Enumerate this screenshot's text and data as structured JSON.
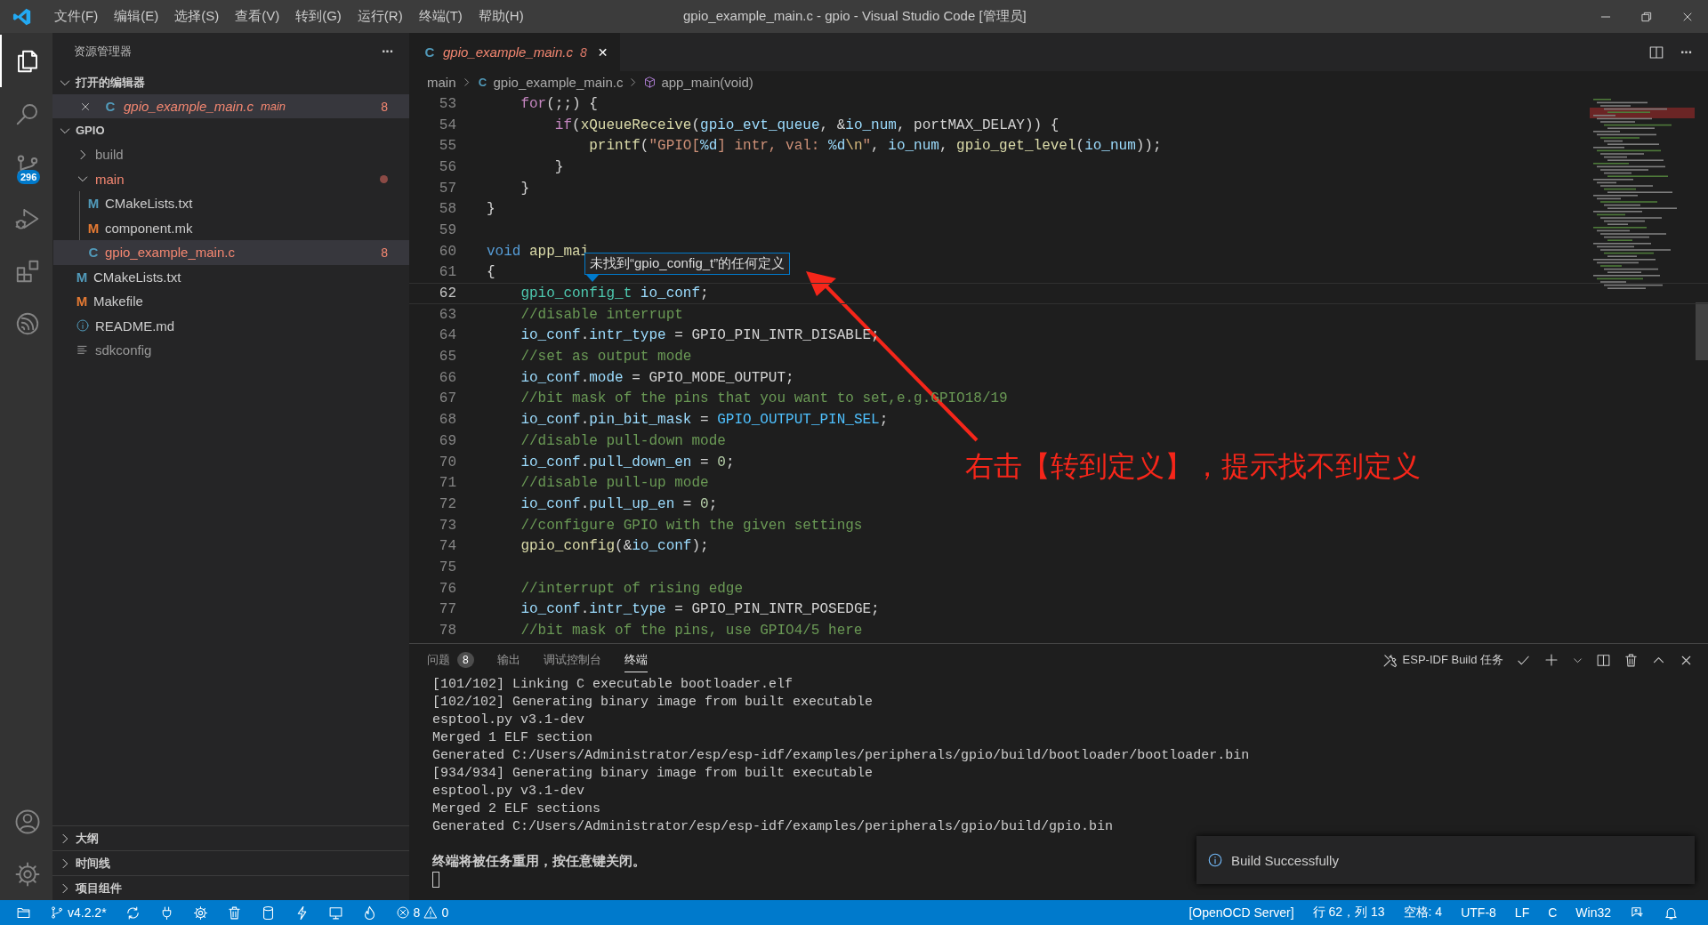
{
  "window": {
    "title": "gpio_example_main.c - gpio - Visual Studio Code [管理员]"
  },
  "menu": [
    "文件(F)",
    "编辑(E)",
    "选择(S)",
    "查看(V)",
    "转到(G)",
    "运行(R)",
    "终端(T)",
    "帮助(H)"
  ],
  "activity_bar": [
    {
      "kind": "explorer",
      "selected": true
    },
    {
      "kind": "search",
      "selected": false
    },
    {
      "kind": "scm",
      "selected": false,
      "badge": "296"
    },
    {
      "kind": "debug",
      "selected": false
    },
    {
      "kind": "extensions",
      "selected": false
    },
    {
      "kind": "espressif",
      "selected": false
    }
  ],
  "activity_bottom": [
    {
      "kind": "account"
    },
    {
      "kind": "settings"
    }
  ],
  "sidebar": {
    "title": "资源管理器",
    "more": "···",
    "open_editors": {
      "title": "打开的编辑器",
      "expanded": true,
      "items": [
        {
          "icon": "C",
          "kind": "c",
          "name": "gpio_example_main.c",
          "description": "main",
          "badge": "8",
          "error": true
        }
      ]
    },
    "folder": {
      "title": "GPIO",
      "expanded": true,
      "items": [
        {
          "name": "build",
          "kind": "folder",
          "expanded": false,
          "error": false,
          "dot": false
        },
        {
          "name": "main",
          "kind": "folder",
          "expanded": true,
          "error": true,
          "dot": true,
          "children": [
            {
              "icon": "M",
              "name": "CMakeLists.txt",
              "kind": "cmake",
              "error": false,
              "dot": false,
              "selected": false
            },
            {
              "icon": "M",
              "name": "component.mk",
              "kind": "make",
              "error": false,
              "dot": false,
              "selected": false
            },
            {
              "icon": "C",
              "name": "gpio_example_main.c",
              "kind": "c",
              "error": true,
              "dot": false,
              "badge": "8",
              "selected": true
            }
          ]
        },
        {
          "icon": "M",
          "name": "CMakeLists.txt",
          "kind": "cmake",
          "error": false,
          "dot": false,
          "selected": false
        },
        {
          "icon": "M",
          "name": "Makefile",
          "kind": "make",
          "error": false,
          "dot": false,
          "selected": false
        },
        {
          "name": "README.md",
          "kind": "info",
          "error": false,
          "dot": false,
          "selected": false
        },
        {
          "name": "sdkconfig",
          "kind": "config",
          "error": false,
          "dot": false,
          "selected": false
        }
      ]
    },
    "sections": [
      {
        "title": "大纲",
        "expanded": false
      },
      {
        "title": "时间线",
        "expanded": false
      },
      {
        "title": "项目组件",
        "expanded": false
      }
    ]
  },
  "tabs": [
    {
      "icon": "C",
      "label": "gpio_example_main.c",
      "badge": "8",
      "selected": true,
      "close": "✕"
    }
  ],
  "breadcrumb": [
    {
      "kind": "folder",
      "text": "main"
    },
    {
      "kind": "file",
      "icon": "C",
      "text": "gpio_example_main.c"
    },
    {
      "kind": "symbol",
      "text": "app_main(void)"
    }
  ],
  "code": [
    {
      "number": "53",
      "current": false,
      "tokens": [
        {
          "text": "    for",
          "kind": "ctl"
        },
        {
          "text": "(;;) {",
          "kind": "plain"
        }
      ]
    },
    {
      "number": "54",
      "current": false,
      "tokens": [
        {
          "text": "        if",
          "kind": "ctl"
        },
        {
          "text": "(",
          "kind": "plain"
        },
        {
          "text": "xQueueReceive",
          "kind": "fn"
        },
        {
          "text": "(",
          "kind": "plain"
        },
        {
          "text": "gpio_evt_queue",
          "kind": "var"
        },
        {
          "text": ", &",
          "kind": "plain"
        },
        {
          "text": "io_num",
          "kind": "var"
        },
        {
          "text": ", portMAX_DELAY)) {",
          "kind": "plain"
        }
      ]
    },
    {
      "number": "55",
      "current": false,
      "tokens": [
        {
          "text": "            printf",
          "kind": "fn"
        },
        {
          "text": "(",
          "kind": "plain"
        },
        {
          "text": "\"GPIO[",
          "kind": "str"
        },
        {
          "text": "%d",
          "kind": "var"
        },
        {
          "text": "] intr, val: ",
          "kind": "str"
        },
        {
          "text": "%d",
          "kind": "var"
        },
        {
          "text": "\\n",
          "kind": "esc"
        },
        {
          "text": "\"",
          "kind": "str"
        },
        {
          "text": ", ",
          "kind": "plain"
        },
        {
          "text": "io_num",
          "kind": "var"
        },
        {
          "text": ", ",
          "kind": "plain"
        },
        {
          "text": "gpio_get_level",
          "kind": "fn"
        },
        {
          "text": "(",
          "kind": "plain"
        },
        {
          "text": "io_num",
          "kind": "var"
        },
        {
          "text": "));",
          "kind": "plain"
        }
      ]
    },
    {
      "number": "56",
      "current": false,
      "tokens": [
        {
          "text": "        }",
          "kind": "plain"
        }
      ]
    },
    {
      "number": "57",
      "current": false,
      "tokens": [
        {
          "text": "    }",
          "kind": "plain"
        }
      ]
    },
    {
      "number": "58",
      "current": false,
      "tokens": [
        {
          "text": "}",
          "kind": "plain"
        }
      ]
    },
    {
      "number": "59",
      "current": false
    },
    {
      "number": "60",
      "current": false,
      "tokens": [
        {
          "text": "void",
          "kind": "kw"
        },
        {
          "text": " app_mai",
          "kind": "fn"
        }
      ]
    },
    {
      "number": "61",
      "current": false,
      "tokens": [
        {
          "text": "{",
          "kind": "plain"
        }
      ]
    },
    {
      "number": "62",
      "current": true,
      "tokens": [
        {
          "text": "    gpio_config_t",
          "kind": "type"
        },
        {
          "text": " io_conf",
          "kind": "var"
        },
        {
          "text": ";",
          "kind": "plain"
        }
      ]
    },
    {
      "number": "63",
      "current": false,
      "tokens": [
        {
          "text": "    //disable interrupt",
          "kind": "cmt"
        }
      ]
    },
    {
      "number": "64",
      "current": false,
      "tokens": [
        {
          "text": "    io_conf",
          "kind": "var"
        },
        {
          "text": ".",
          "kind": "plain"
        },
        {
          "text": "intr_type",
          "kind": "var"
        },
        {
          "text": " = GPIO_PIN_INTR_DISABLE;",
          "kind": "plain"
        }
      ]
    },
    {
      "number": "65",
      "current": false,
      "tokens": [
        {
          "text": "    //set as output mode",
          "kind": "cmt"
        }
      ]
    },
    {
      "number": "66",
      "current": false,
      "tokens": [
        {
          "text": "    io_conf",
          "kind": "var"
        },
        {
          "text": ".",
          "kind": "plain"
        },
        {
          "text": "mode",
          "kind": "var"
        },
        {
          "text": " = GPIO_MODE_OUTPUT;",
          "kind": "plain"
        }
      ]
    },
    {
      "number": "67",
      "current": false,
      "tokens": [
        {
          "text": "    //bit mask of the pins that you want to set,e.g.GPIO18/19",
          "kind": "cmt"
        }
      ]
    },
    {
      "number": "68",
      "current": false,
      "tokens": [
        {
          "text": "    io_conf",
          "kind": "var"
        },
        {
          "text": ".",
          "kind": "plain"
        },
        {
          "text": "pin_bit_mask",
          "kind": "var"
        },
        {
          "text": " = ",
          "kind": "plain"
        },
        {
          "text": "GPIO_OUTPUT_PIN_SEL",
          "kind": "macro"
        },
        {
          "text": ";",
          "kind": "plain"
        }
      ]
    },
    {
      "number": "69",
      "current": false,
      "tokens": [
        {
          "text": "    //disable pull-down mode",
          "kind": "cmt"
        }
      ]
    },
    {
      "number": "70",
      "current": false,
      "tokens": [
        {
          "text": "    io_conf",
          "kind": "var"
        },
        {
          "text": ".",
          "kind": "plain"
        },
        {
          "text": "pull_down_en",
          "kind": "var"
        },
        {
          "text": " = ",
          "kind": "plain"
        },
        {
          "text": "0",
          "kind": "num"
        },
        {
          "text": ";",
          "kind": "plain"
        }
      ]
    },
    {
      "number": "71",
      "current": false,
      "tokens": [
        {
          "text": "    //disable pull-up mode",
          "kind": "cmt"
        }
      ]
    },
    {
      "number": "72",
      "current": false,
      "tokens": [
        {
          "text": "    io_conf",
          "kind": "var"
        },
        {
          "text": ".",
          "kind": "plain"
        },
        {
          "text": "pull_up_en",
          "kind": "var"
        },
        {
          "text": " = ",
          "kind": "plain"
        },
        {
          "text": "0",
          "kind": "num"
        },
        {
          "text": ";",
          "kind": "plain"
        }
      ]
    },
    {
      "number": "73",
      "current": false,
      "tokens": [
        {
          "text": "    //configure GPIO with the given settings",
          "kind": "cmt"
        }
      ]
    },
    {
      "number": "74",
      "current": false,
      "tokens": [
        {
          "text": "    gpio_config",
          "kind": "fn"
        },
        {
          "text": "(&",
          "kind": "plain"
        },
        {
          "text": "io_conf",
          "kind": "var"
        },
        {
          "text": ");",
          "kind": "plain"
        }
      ]
    },
    {
      "number": "75",
      "current": false
    },
    {
      "number": "76",
      "current": false,
      "tokens": [
        {
          "text": "    //interrupt of rising edge",
          "kind": "cmt"
        }
      ]
    },
    {
      "number": "77",
      "current": false,
      "tokens": [
        {
          "text": "    io_conf",
          "kind": "var"
        },
        {
          "text": ".",
          "kind": "plain"
        },
        {
          "text": "intr_type",
          "kind": "var"
        },
        {
          "text": " = GPIO_PIN_INTR_POSEDGE;",
          "kind": "plain"
        }
      ]
    },
    {
      "number": "78",
      "current": false,
      "tokens": [
        {
          "text": "    //bit mask of the pins, use GPIO4/5 here",
          "kind": "cmt"
        }
      ]
    }
  ],
  "tooltip": "未找到“gpio_config_t”的任何定义",
  "annotation": "右击【转到定义】，提示找不到定义",
  "panel": {
    "tabs": [
      {
        "label": "问题",
        "badge": "8",
        "selected": false
      },
      {
        "label": "输出",
        "selected": false
      },
      {
        "label": "调试控制台",
        "selected": false
      },
      {
        "label": "终端",
        "selected": true
      }
    ],
    "task": "ESP-IDF Build 任务",
    "terminal": [
      "[101/102] Linking C executable bootloader.elf",
      "[102/102] Generating binary image from built executable",
      "esptool.py v3.1-dev",
      "Merged 1 ELF section",
      "Generated C:/Users/Administrator/esp/esp-idf/examples/peripherals/gpio/build/bootloader/bootloader.bin",
      "[934/934] Generating binary image from built executable",
      "esptool.py v3.1-dev",
      "Merged 2 ELF sections",
      "Generated C:/Users/Administrator/esp/esp-idf/examples/peripherals/gpio/build/gpio.bin"
    ],
    "terminal_notice": "终端将被任务重用，按任意键关闭。"
  },
  "notification": {
    "message": "Build Successfully"
  },
  "status_left": [
    {
      "kind": "remote"
    },
    {
      "kind": "branch",
      "text": "v4.2.2*"
    },
    {
      "kind": "sync"
    },
    {
      "kind": "plug"
    },
    {
      "kind": "gear"
    },
    {
      "kind": "trash"
    },
    {
      "kind": "database"
    },
    {
      "kind": "flash"
    },
    {
      "kind": "monitor"
    },
    {
      "kind": "flame"
    },
    {
      "kind": "problems",
      "errors": "8",
      "warnings": "0"
    }
  ],
  "status_right": [
    {
      "kind": "text",
      "text": "[OpenOCD Server]"
    },
    {
      "kind": "text",
      "text": "行 62，列 13"
    },
    {
      "kind": "text",
      "text": "空格: 4"
    },
    {
      "kind": "text",
      "text": "UTF-8"
    },
    {
      "kind": "text",
      "text": "LF"
    },
    {
      "kind": "text",
      "text": "C"
    },
    {
      "kind": "text",
      "text": "Win32"
    },
    {
      "kind": "feedback"
    },
    {
      "kind": "bell"
    }
  ]
}
